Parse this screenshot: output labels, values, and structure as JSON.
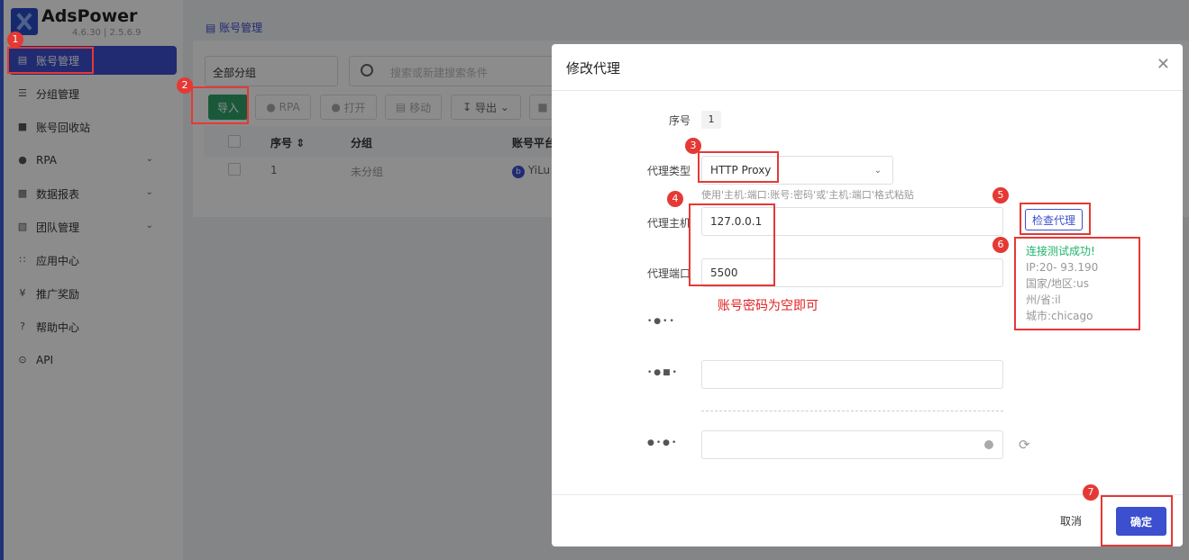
{
  "app": {
    "brand": "AdsPower",
    "version": "4.6.30 | 2.5.6.9"
  },
  "sidebar": {
    "items": [
      {
        "label": "账号管理",
        "icon": "list-icon",
        "active": true
      },
      {
        "label": "分组管理",
        "icon": "group-icon"
      },
      {
        "label": "账号回收站",
        "icon": "trash-icon"
      },
      {
        "label": "RPA",
        "icon": "robot-icon",
        "expandable": true
      },
      {
        "label": "数据报表",
        "icon": "chart-icon",
        "expandable": true
      },
      {
        "label": "团队管理",
        "icon": "team-icon",
        "expandable": true
      },
      {
        "label": "应用中心",
        "icon": "apps-icon"
      },
      {
        "label": "推广奖励",
        "icon": "reward-icon"
      },
      {
        "label": "帮助中心",
        "icon": "help-icon"
      },
      {
        "label": "API",
        "icon": "api-icon"
      }
    ]
  },
  "main": {
    "breadcrumb": "账号管理",
    "group_select": "全部分组",
    "search_placeholder": "搜索或新建搜索条件",
    "toolbar": {
      "import": "导入",
      "rpa": "RPA",
      "open": "打开",
      "move": "移动",
      "export": "导出"
    },
    "table": {
      "headers": {
        "seq": "序号",
        "group": "分组",
        "platform": "账号平台"
      },
      "rows": [
        {
          "seq": "1",
          "group": "未分组",
          "platform": "YiLu"
        }
      ]
    }
  },
  "modal": {
    "title": "修改代理",
    "seq_label": "序号",
    "seq_value": "1",
    "proxy_type_label": "代理类型",
    "proxy_type_value": "HTTP Proxy",
    "paste_hint": "使用'主机:端口:账号:密码'或'主机:端口'格式粘贴",
    "host_label": "代理主机",
    "host_value": "127.0.0.1",
    "port_label": "代理端口",
    "port_value": "5500",
    "check_button": "检查代理",
    "result": {
      "status": "连接测试成功!",
      "ip": "IP:20-        93.190",
      "country": "国家/地区:us",
      "state": "州/省:il",
      "city": "城市:chicago"
    },
    "note": "账号密码为空即可",
    "cancel": "取消",
    "confirm": "确定"
  },
  "annotations": [
    "1",
    "2",
    "3",
    "4",
    "5",
    "6",
    "7"
  ],
  "colors": {
    "accent": "#3b4fcf",
    "annotation": "#e53935",
    "success": "#1fb36b",
    "import": "#2fa36b"
  }
}
